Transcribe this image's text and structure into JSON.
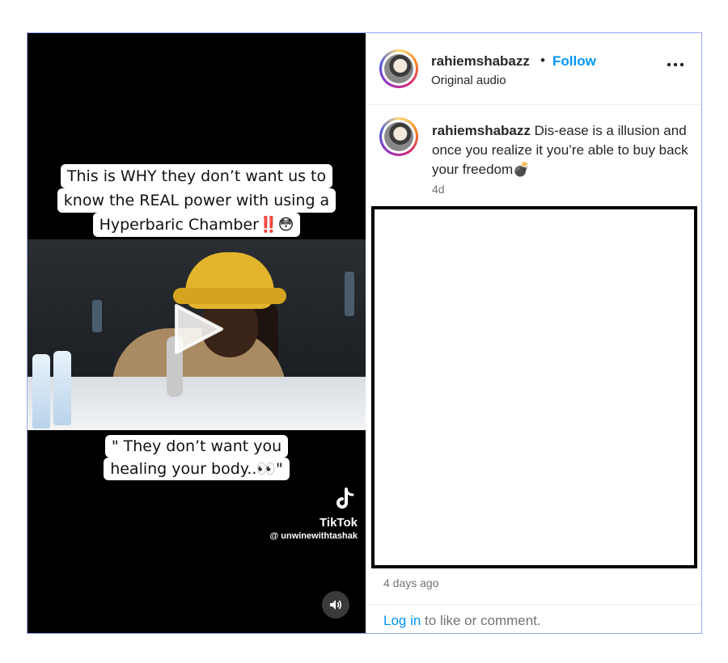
{
  "post": {
    "username": "rahiemshabazz",
    "separator": "•",
    "follow_label": "Follow",
    "audio_label": "Original audio"
  },
  "media": {
    "caption_top_lines": [
      "This is WHY they don’t want us to",
      "know the REAL power with using a",
      "Hyperbaric Chamber‼️😳"
    ],
    "caption_bottom_lines": [
      "\" They don’t want you",
      "healing your body..👀\""
    ],
    "tiktok_label": "TikTok",
    "tiktok_handle": "@ unwinewithtashak"
  },
  "comment": {
    "username": "rahiemshabazz",
    "text": " Dis-ease is a illusion and once you realize it you’re able to buy back your freedom💣",
    "time": "4d"
  },
  "meta": {
    "days_ago": "4 days ago"
  },
  "footer": {
    "login_label": "Log in",
    "rest_text": " to like or comment."
  },
  "icons": {
    "play": "play-icon",
    "volume": "volume-icon",
    "more": "more-options-icon",
    "tiktok": "tiktok-icon"
  },
  "colors": {
    "follow_blue": "#0095f6",
    "muted_gray": "#737373",
    "text_dark": "#262626"
  }
}
